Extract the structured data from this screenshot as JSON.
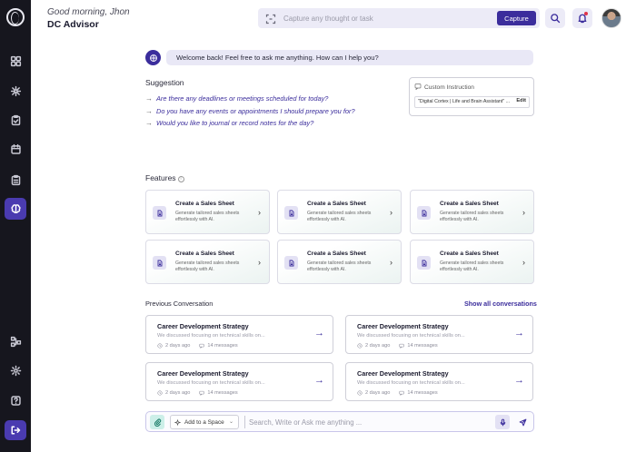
{
  "header": {
    "greeting": "Good morning, Jhon",
    "title": "DC Advisor",
    "capture_placeholder": "Capture any thought or task",
    "capture_button": "Capture"
  },
  "welcome_message": "Welcome back! Feel free to ask me anything. How can I help you?",
  "suggestion": {
    "title": "Suggestion",
    "items": [
      "Are there any deadlines or meetings scheduled for today?",
      "Do you have any events or appointments I should prepare you for?",
      "Would you like to journal or record notes for the day?"
    ]
  },
  "custom_instruction": {
    "title": "Custom Instruction",
    "value": "\"Digital Cortex | Life and Brain Assistant\" ...",
    "edit_label": "Edit"
  },
  "features": {
    "title": "Features",
    "cards": [
      {
        "title": "Create a Sales Sheet",
        "desc": "Generate tailored sales sheets effortlessly with AI."
      },
      {
        "title": "Create a Sales Sheet",
        "desc": "Generate tailored sales sheets effortlessly with AI."
      },
      {
        "title": "Create a Sales Sheet",
        "desc": "Generate tailored sales sheets effortlessly with AI."
      },
      {
        "title": "Create a Sales Sheet",
        "desc": "Generate tailored sales sheets effortlessly with AI."
      },
      {
        "title": "Create a Sales Sheet",
        "desc": "Generate tailored sales sheets effortlessly with AI."
      },
      {
        "title": "Create a Sales Sheet",
        "desc": "Generate tailored sales sheets effortlessly with AI."
      }
    ]
  },
  "conversations": {
    "title": "Previous Conversation",
    "show_all": "Show all conversations",
    "items": [
      {
        "title": "Career Development Strategy",
        "snippet": "We discussed focusing on technical skills on...",
        "time": "2 days ago",
        "messages": "14 messages"
      },
      {
        "title": "Career Development Strategy",
        "snippet": "We discussed focusing on technical skills on...",
        "time": "2 days ago",
        "messages": "14 messages"
      },
      {
        "title": "Career Development Strategy",
        "snippet": "We discussed focusing on technical skills on...",
        "time": "2 days ago",
        "messages": "14 messages"
      },
      {
        "title": "Career Development Strategy",
        "snippet": "We discussed focusing on technical skills on...",
        "time": "2 days ago",
        "messages": "14 messages"
      }
    ]
  },
  "composer": {
    "space_button": "Add to a Space",
    "placeholder": "Search, Write or Ask me anything ..."
  },
  "colors": {
    "accent": "#3b2d9c",
    "sidebar_bg": "#16161e",
    "sidebar_active": "#4a3bb0"
  }
}
